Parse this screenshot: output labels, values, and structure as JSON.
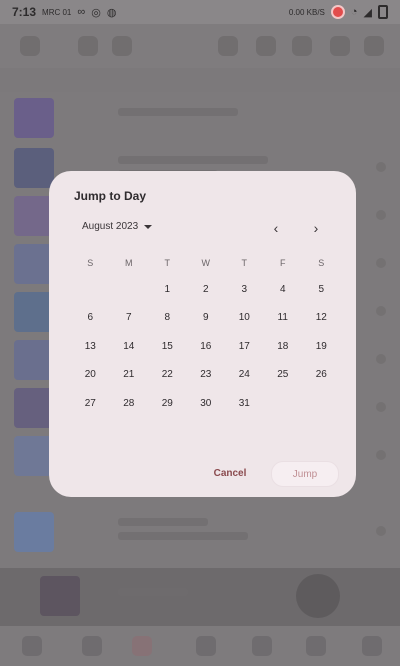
{
  "status_bar": {
    "time": "7:13",
    "extra": "MRC 01",
    "icons": [
      "link-icon",
      "cast-icon",
      "data-icon"
    ],
    "speed": "0.00",
    "speed_unit": "KB/S",
    "right_icons": [
      "record-icon",
      "wifi-icon",
      "signal-icon",
      "battery-icon"
    ]
  },
  "dialog": {
    "title": "Jump to Day",
    "month_label": "August 2023",
    "weekdays": [
      "S",
      "M",
      "T",
      "W",
      "T",
      "F",
      "S"
    ],
    "weeks": [
      [
        "",
        "",
        "1",
        "2",
        "3",
        "4",
        "5"
      ],
      [
        "6",
        "7",
        "8",
        "9",
        "10",
        "11",
        "12"
      ],
      [
        "13",
        "14",
        "15",
        "16",
        "17",
        "18",
        "19"
      ],
      [
        "20",
        "21",
        "22",
        "23",
        "24",
        "25",
        "26"
      ],
      [
        "27",
        "28",
        "29",
        "30",
        "31",
        "",
        ""
      ]
    ],
    "prev_icon": "chevron-left-icon",
    "next_icon": "chevron-right-icon",
    "cancel_label": "Cancel",
    "jump_label": "Jump"
  },
  "colors": {
    "scrim": "#7d7a7c",
    "dialog_bg": "#efe6e9",
    "accent": "#8a4a4e"
  }
}
